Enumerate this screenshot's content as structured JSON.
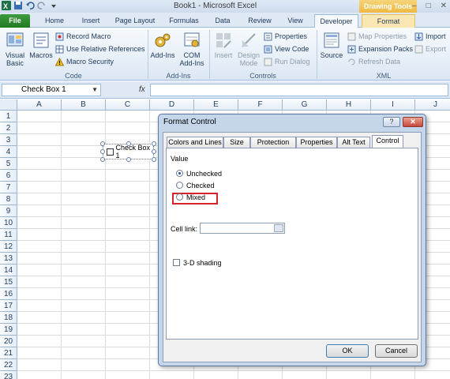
{
  "window": {
    "title": "Book1  -  Microsoft Excel",
    "context_tab": "Drawing Tools",
    "controls": [
      "–",
      "□",
      "✕"
    ]
  },
  "tabs": [
    "File",
    "Home",
    "Insert",
    "Page Layout",
    "Formulas",
    "Data",
    "Review",
    "View",
    "Developer",
    "Format"
  ],
  "ribbon": {
    "code": {
      "visual_basic": "Visual Basic",
      "macros": "Macros",
      "record_macro": "Record Macro",
      "use_relative_references": "Use Relative References",
      "macro_security": "Macro Security",
      "label": "Code"
    },
    "addins": {
      "addins": "Add-Ins",
      "com_addins": "COM Add-Ins",
      "label": "Add-Ins"
    },
    "controls": {
      "insert": "Insert",
      "design_mode": "Design Mode",
      "properties": "Properties",
      "view_code": "View Code",
      "run_dialog": "Run Dialog",
      "label": "Controls"
    },
    "xml": {
      "source": "Source",
      "map_properties": "Map Properties",
      "expansion_packs": "Expansion Packs",
      "refresh_data": "Refresh Data",
      "import": "Import",
      "export": "Export",
      "label": "XML"
    }
  },
  "formula_bar": {
    "name_box": "Check Box 1",
    "fx": "fx",
    "value": ""
  },
  "sheet": {
    "columns": [
      "A",
      "B",
      "C",
      "D",
      "E",
      "F",
      "G",
      "H",
      "I",
      "J"
    ],
    "rows": [
      "1",
      "2",
      "3",
      "4",
      "5",
      "6",
      "7",
      "8",
      "9",
      "10",
      "11",
      "12",
      "13",
      "14",
      "15",
      "16",
      "17",
      "18",
      "19",
      "20",
      "21",
      "22",
      "23"
    ],
    "checkbox_label": "Check Box 1"
  },
  "dialog": {
    "title": "Format Control",
    "help": "?",
    "close": "✕",
    "tabs": [
      "Colors and Lines",
      "Size",
      "Protection",
      "Properties",
      "Alt Text",
      "Control"
    ],
    "active_tab": "Control",
    "value_label": "Value",
    "options": [
      "Unchecked",
      "Checked",
      "Mixed"
    ],
    "selected_option": "Unchecked",
    "cell_link_label": "Cell link:",
    "cell_link_value": "",
    "shading_label": "3-D shading",
    "shading_checked": false,
    "ok": "OK",
    "cancel": "Cancel"
  },
  "colors": {
    "file_tab": "#2e8b2e",
    "highlight": "#d6222a",
    "drawing_tools": "#f0b940"
  }
}
